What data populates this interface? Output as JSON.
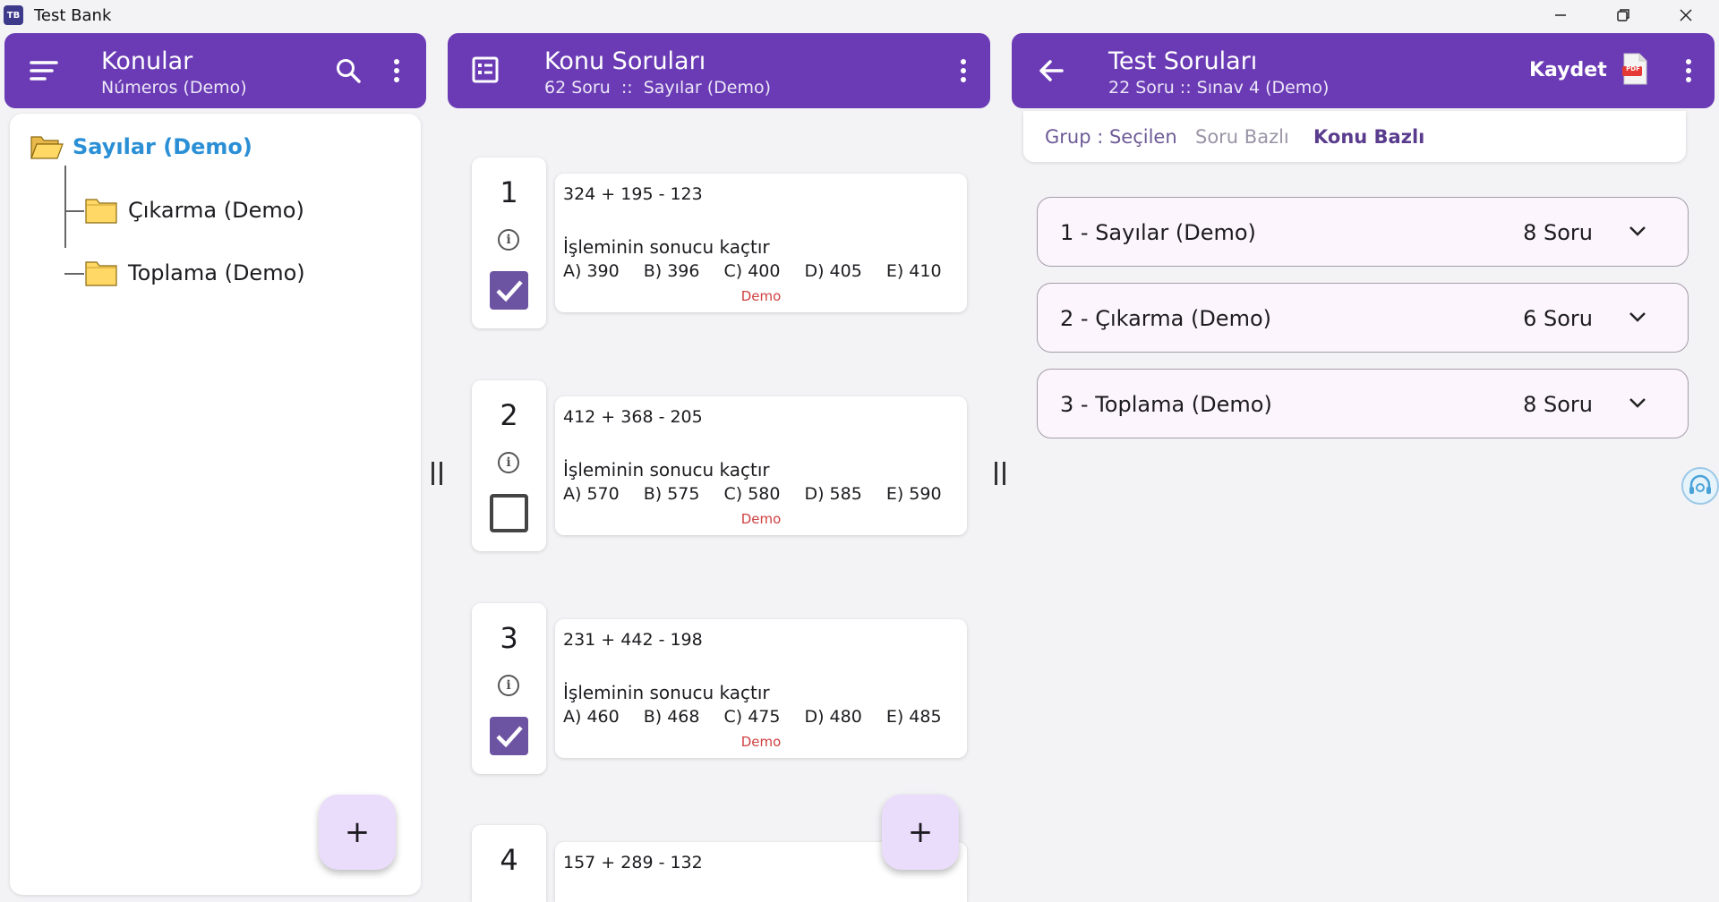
{
  "window": {
    "title": "Test Bank",
    "icon_text": "TB"
  },
  "left_panel": {
    "title": "Konular",
    "subtitle": "Números (Demo)",
    "tree": {
      "root": "Sayılar (Demo)",
      "children": [
        "Çıkarma (Demo)",
        "Toplama (Demo)"
      ]
    },
    "fab_label": "+"
  },
  "middle_panel": {
    "title": "Konu Soruları",
    "subtitle": "62 Soru  ::  Sayılar (Demo)",
    "questions": [
      {
        "num": "1",
        "expr": "324 + 195 - 123",
        "text": "İşleminin sonucu kaçtır",
        "options": [
          "A) 390",
          "B) 396",
          "C) 400",
          "D) 405",
          "E) 410"
        ],
        "tag": "Demo",
        "checked": true
      },
      {
        "num": "2",
        "expr": "412 + 368 - 205",
        "text": "İşleminin sonucu kaçtır",
        "options": [
          "A) 570",
          "B) 575",
          "C) 580",
          "D) 585",
          "E) 590"
        ],
        "tag": "Demo",
        "checked": false
      },
      {
        "num": "3",
        "expr": "231 + 442 - 198",
        "text": "İşleminin sonucu kaçtır",
        "options": [
          "A) 460",
          "B) 468",
          "C) 475",
          "D) 480",
          "E) 485"
        ],
        "tag": "Demo",
        "checked": true
      },
      {
        "num": "4",
        "expr": "157 + 289 - 132",
        "text": "",
        "options": [],
        "tag": "",
        "checked": false
      }
    ],
    "info_glyph": "i",
    "fab_label": "+"
  },
  "right_panel": {
    "title": "Test Soruları",
    "subtitle": "22 Soru :: Sınav 4 (Demo)",
    "save_label": "Kaydet",
    "pdf_label": "PDF",
    "tabs": [
      {
        "label": "Grup : Seçilen",
        "active": false
      },
      {
        "label": "Soru Bazlı",
        "active": false
      },
      {
        "label": "Konu Bazlı",
        "active": true
      }
    ],
    "groups": [
      {
        "label": "1 - Sayılar (Demo)",
        "count": "8 Soru"
      },
      {
        "label": "2 - Çıkarma (Demo)",
        "count": "6 Soru"
      },
      {
        "label": "3 - Toplama (Demo)",
        "count": "8 Soru"
      }
    ]
  },
  "colors": {
    "header": "#6a3bb5",
    "checkbox": "#6d54a3",
    "tree_root": "#2b8fd6",
    "demo_tag": "#d04040",
    "fab": "#eadcfb"
  }
}
